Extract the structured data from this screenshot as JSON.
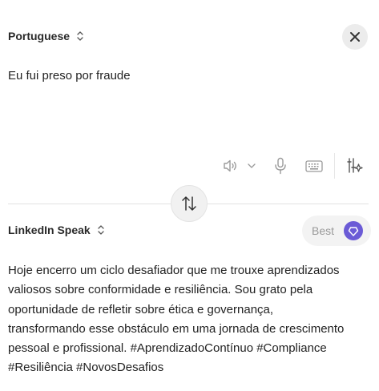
{
  "source": {
    "language": "Portuguese",
    "text": "Eu fui preso por fraude"
  },
  "target": {
    "language": "LinkedIn Speak",
    "best_label": "Best",
    "output_lines": [
      "Hoje encerro um ciclo desafiador que me trouxe aprendizados",
      "valiosos sobre conformidade e resiliência. Sou grato pela",
      "oportunidade de refletir sobre ética e governança,",
      "transformando esse obstáculo em uma jornada de crescimento",
      "pessoal e profissional. #AprendizadoContínuo #Compliance",
      "#Resiliência #NovosDesafios"
    ]
  },
  "colors": {
    "accent": "#6b5bd6",
    "icon_gray": "#9a9a9a"
  },
  "icons": [
    "chevron-updown-icon",
    "close-icon",
    "speaker-icon",
    "chevron-down-icon",
    "microphone-icon",
    "keyboard-icon",
    "sliders-sparkle-icon",
    "swap-icon",
    "heart-diamond-icon"
  ]
}
